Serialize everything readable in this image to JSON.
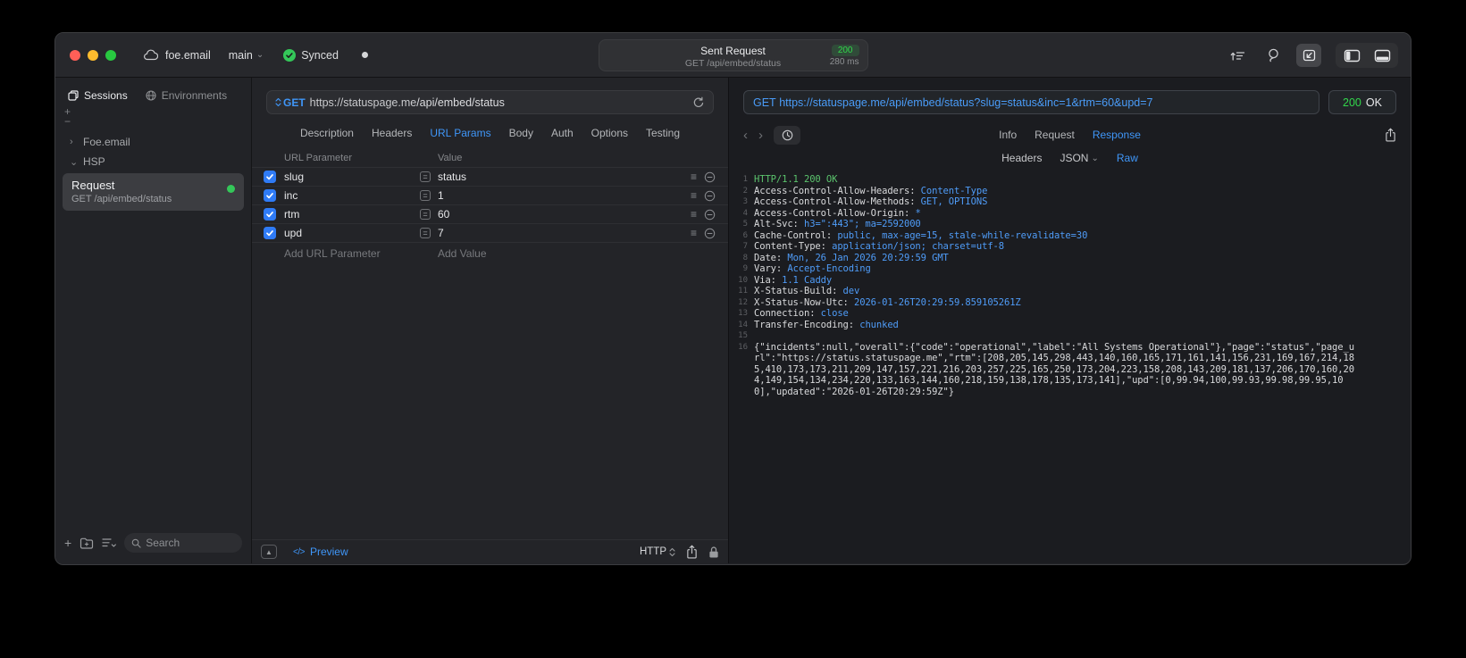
{
  "colors": {
    "accent_blue": "#3f96f8",
    "status_green": "#32d74b",
    "header_value_blue": "#4f9cf8",
    "status_line_green": "#5bc46d",
    "checkbox_blue": "#2f7bf6"
  },
  "icons": {
    "plus": "+",
    "minus": "−",
    "chevron_right": "›",
    "chevron_down": "⌄",
    "back": "‹",
    "forward": "›",
    "equals": "=",
    "hamburger": "≡",
    "code": "</>",
    "panel_up": "▲"
  },
  "chrome": {
    "project": "foe.email",
    "branch": "main",
    "sync_label": "Synced",
    "center": {
      "title": "Sent Request",
      "status_code": "200",
      "request_line": "GET /api/embed/status",
      "duration": "280 ms"
    }
  },
  "sidebar": {
    "tabs": [
      {
        "label": "Sessions",
        "active": true
      },
      {
        "label": "Environments",
        "active": false
      }
    ],
    "tree": [
      {
        "label": "Foe.email",
        "expanded": false
      },
      {
        "label": "HSP",
        "expanded": true
      }
    ],
    "selected_request": {
      "title": "Request",
      "subtitle": "GET /api/embed/status"
    },
    "search_placeholder": "Search"
  },
  "request_editor": {
    "method": "GET",
    "url_host": "https://statuspage.me",
    "url_path": "/api/embed/status",
    "tabs": [
      "Description",
      "Headers",
      "URL Params",
      "Body",
      "Auth",
      "Options",
      "Testing"
    ],
    "active_tab": "URL Params",
    "params": {
      "columns": [
        "URL Parameter",
        "Value"
      ],
      "rows": [
        {
          "name": "slug",
          "value": "status",
          "checked": true
        },
        {
          "name": "inc",
          "value": "1",
          "checked": true
        },
        {
          "name": "rtm",
          "value": "60",
          "checked": true
        },
        {
          "name": "upd",
          "value": "7",
          "checked": true
        }
      ],
      "add_name": "Add URL Parameter",
      "add_value": "Add Value"
    },
    "footer": {
      "preview": "Preview",
      "protocol": "HTTP"
    }
  },
  "response_viewer": {
    "method": "GET",
    "url": "https://statuspage.me/api/embed/status?slug=status&inc=1&rtm=60&upd=7",
    "status_code": "200",
    "status_text": "OK",
    "tabs": [
      "Info",
      "Request",
      "Response"
    ],
    "active_tab": "Response",
    "subtabs": [
      {
        "label": "Headers"
      },
      {
        "label": "JSON",
        "menu": true
      },
      {
        "label": "Raw"
      }
    ],
    "active_subtab": "Raw",
    "lines": [
      {
        "n": "1",
        "segs": [
          [
            "g",
            "HTTP/1.1 200 OK"
          ]
        ]
      },
      {
        "n": "2",
        "segs": [
          [
            "w",
            "Access-Control-Allow-Headers: "
          ],
          [
            "b",
            "Content-Type"
          ]
        ]
      },
      {
        "n": "3",
        "segs": [
          [
            "w",
            "Access-Control-Allow-Methods: "
          ],
          [
            "b",
            "GET, OPTIONS"
          ]
        ]
      },
      {
        "n": "4",
        "segs": [
          [
            "w",
            "Access-Control-Allow-Origin: "
          ],
          [
            "b",
            "*"
          ]
        ]
      },
      {
        "n": "5",
        "segs": [
          [
            "w",
            "Alt-Svc: "
          ],
          [
            "b",
            "h3=\":443\"; ma=2592000"
          ]
        ]
      },
      {
        "n": "6",
        "segs": [
          [
            "w",
            "Cache-Control: "
          ],
          [
            "b",
            "public, max-age=15, stale-while-revalidate=30"
          ]
        ]
      },
      {
        "n": "7",
        "segs": [
          [
            "w",
            "Content-Type: "
          ],
          [
            "b",
            "application/json; charset=utf-8"
          ]
        ]
      },
      {
        "n": "8",
        "segs": [
          [
            "w",
            "Date: "
          ],
          [
            "b",
            "Mon, 26 Jan 2026 20:29:59 GMT"
          ]
        ]
      },
      {
        "n": "9",
        "segs": [
          [
            "w",
            "Vary: "
          ],
          [
            "b",
            "Accept-Encoding"
          ]
        ]
      },
      {
        "n": "10",
        "segs": [
          [
            "w",
            "Via: "
          ],
          [
            "b",
            "1.1 Caddy"
          ]
        ]
      },
      {
        "n": "11",
        "segs": [
          [
            "w",
            "X-Status-Build: "
          ],
          [
            "b",
            "dev"
          ]
        ]
      },
      {
        "n": "12",
        "segs": [
          [
            "w",
            "X-Status-Now-Utc: "
          ],
          [
            "b",
            "2026-01-26T20:29:59.859105261Z"
          ]
        ]
      },
      {
        "n": "13",
        "segs": [
          [
            "w",
            "Connection: "
          ],
          [
            "b",
            "close"
          ]
        ]
      },
      {
        "n": "14",
        "segs": [
          [
            "w",
            "Transfer-Encoding: "
          ],
          [
            "b",
            "chunked"
          ]
        ]
      },
      {
        "n": "15",
        "segs": []
      },
      {
        "n": "16",
        "segs": [
          [
            "w",
            "{\"incidents\":null,\"overall\":{\"code\":\"operational\",\"label\":\"All Systems Operational\"},\"page\":\"status\",\"page_url\":\"https://status.statuspage.me\",\"rtm\":[208,205,145,298,443,140,160,165,171,161,141,156,231,169,167,214,185,410,173,173,211,209,147,157,221,216,203,257,225,165,250,173,204,223,158,208,143,209,181,137,206,170,160,204,149,154,134,234,220,133,163,144,160,218,159,138,178,135,173,141],\"upd\":[0,99.94,100,99.93,99.98,99.95,100],\"updated\":\"2026-01-26T20:29:59Z\"}"
          ]
        ]
      }
    ]
  }
}
